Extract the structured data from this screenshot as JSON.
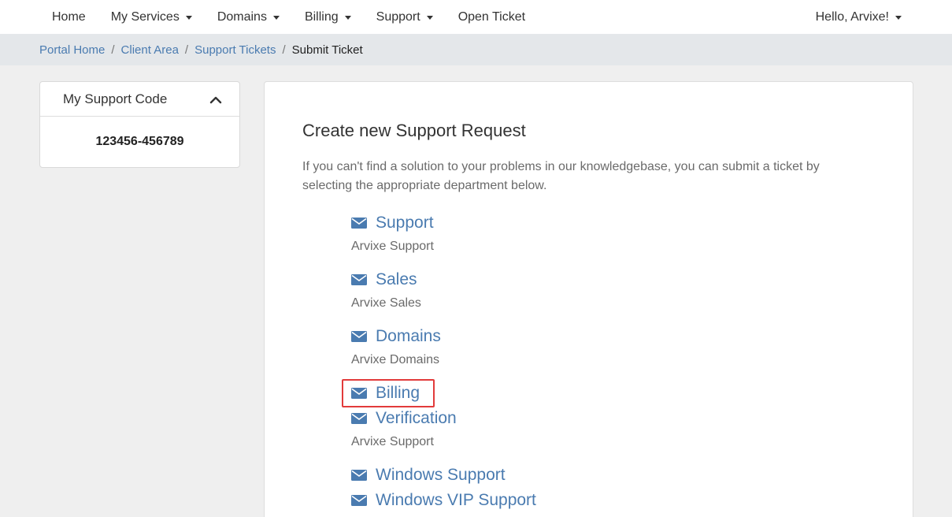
{
  "nav": {
    "items": [
      {
        "label": "Home",
        "dropdown": false
      },
      {
        "label": "My Services",
        "dropdown": true
      },
      {
        "label": "Domains",
        "dropdown": true
      },
      {
        "label": "Billing",
        "dropdown": true
      },
      {
        "label": "Support",
        "dropdown": true
      },
      {
        "label": "Open Ticket",
        "dropdown": false
      }
    ],
    "user_greeting": "Hello, Arvixe!"
  },
  "breadcrumb": {
    "items": [
      "Portal Home",
      "Client Area",
      "Support Tickets"
    ],
    "separator": "/",
    "active": "Submit Ticket"
  },
  "sidebar": {
    "title": "My Support Code",
    "code": "123456-456789"
  },
  "main": {
    "title": "Create new Support Request",
    "description": "If you can't find a solution to your problems in our knowledgebase, you can submit a ticket by selecting the appropriate department below.",
    "departments": [
      {
        "name": "Support",
        "description": "Arvixe Support"
      },
      {
        "name": "Sales",
        "description": "Arvixe Sales"
      },
      {
        "name": "Domains",
        "description": "Arvixe Domains"
      },
      {
        "name": "Billing",
        "description": ""
      },
      {
        "name": "Verification",
        "description": "Arvixe Support"
      },
      {
        "name": "Windows Support",
        "description": ""
      },
      {
        "name": "Windows VIP Support",
        "description": ""
      }
    ]
  },
  "colors": {
    "link": "#4a7bb0",
    "highlight": "#e23b3b"
  },
  "icons": {
    "department": "envelope-icon",
    "collapse": "chevron-up-icon"
  }
}
